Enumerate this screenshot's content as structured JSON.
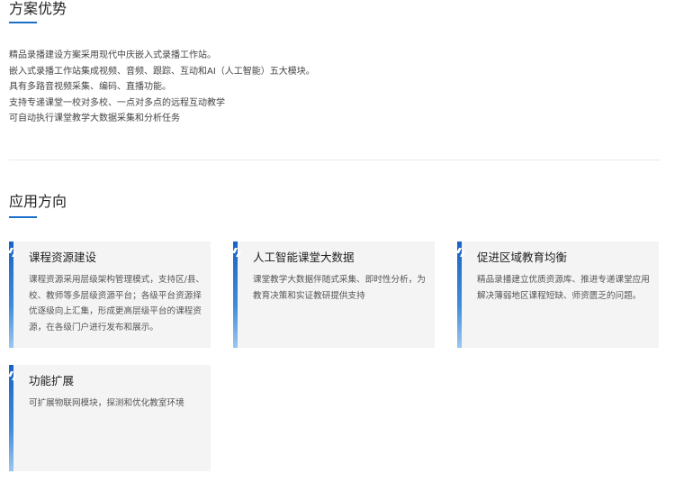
{
  "advantages": {
    "title": "方案优势",
    "lines": [
      "精品录播建设方案采用现代中庆嵌入式录播工作站。",
      "嵌入式录播工作站集成视频、音频、跟踪、互动和AI（人工智能）五大模块。",
      "具有多路音视频采集、编码、直播功能。",
      "支持专递课堂一校对多校、一点对多点的远程互动教学",
      "可自动执行课堂教学大数据采集和分析任务"
    ]
  },
  "applications": {
    "title": "应用方向",
    "cards": [
      {
        "title": "课程资源建设",
        "desc": "课程资源采用层级架构管理模式，支持区/县、校、教师等多层级资源平台；各级平台资源择优逐级向上汇集，形成更高层级平台的课程资源，在各级门户进行发布和展示。"
      },
      {
        "title": "人工智能课堂大数据",
        "desc": "课堂教学大数据伴随式采集、即时性分析，为教育决策和实证教研提供支持"
      },
      {
        "title": "促进区域教育均衡",
        "desc": "精品录播建立优质资源库、推进专递课堂应用解决薄弱地区课程短缺、师资匮乏的问题。"
      },
      {
        "title": "功能扩展",
        "desc": "可扩展物联网模块，探测和优化教室环境"
      }
    ]
  },
  "colors": {
    "accent": "#1a6fc9",
    "card_bg": "#f4f4f4"
  }
}
